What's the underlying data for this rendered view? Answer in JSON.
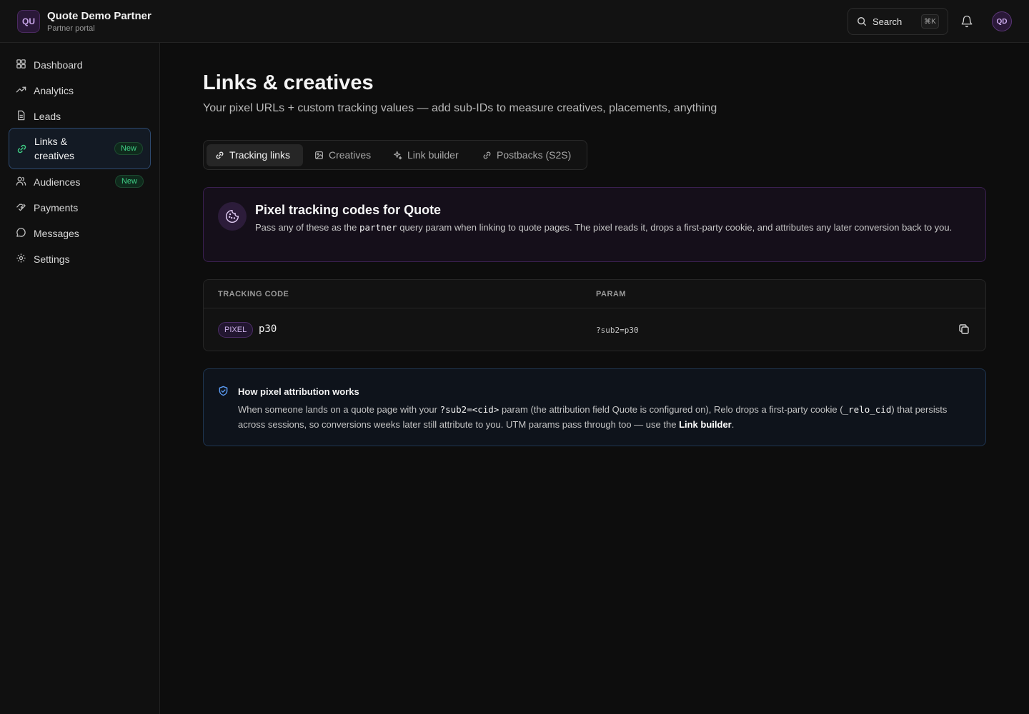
{
  "org": {
    "initials": "QU",
    "name": "Quote Demo Partner",
    "subtitle": "Partner portal"
  },
  "header": {
    "search_label": "Search",
    "search_shortcut": "⌘K",
    "user_initials": "QD"
  },
  "sidebar": {
    "items": [
      {
        "label": "Dashboard",
        "icon": "grid-icon"
      },
      {
        "label": "Analytics",
        "icon": "trend-icon"
      },
      {
        "label": "Leads",
        "icon": "document-icon"
      },
      {
        "label": "Links & creatives",
        "icon": "link-icon",
        "badge": "New",
        "active": true
      },
      {
        "label": "Audiences",
        "icon": "users-icon",
        "badge": "New"
      },
      {
        "label": "Payments",
        "icon": "payments-icon"
      },
      {
        "label": "Messages",
        "icon": "message-icon"
      },
      {
        "label": "Settings",
        "icon": "gear-icon"
      }
    ]
  },
  "main": {
    "title": "Links & creatives",
    "subtitle": "Your pixel URLs + custom tracking values — add sub-IDs to measure creatives, placements, anything",
    "tabs": [
      {
        "label": "Tracking links",
        "icon": "link-icon",
        "active": true
      },
      {
        "label": "Creatives",
        "icon": "image-icon"
      },
      {
        "label": "Link builder",
        "icon": "sparkle-icon"
      },
      {
        "label": "Postbacks (S2S)",
        "icon": "link-icon"
      }
    ]
  },
  "pixel_card": {
    "title": "Pixel tracking codes for Quote",
    "desc_before": "Pass any of these as the ",
    "desc_code": "partner",
    "desc_after": " query param when linking to quote pages. The pixel reads it, drops a first-party cookie, and attributes any later conversion back to you."
  },
  "table": {
    "headers": [
      "TRACKING CODE",
      "PARAM"
    ],
    "rows": [
      {
        "type": "PIXEL",
        "code": "p30",
        "param": "?sub2=p30"
      }
    ]
  },
  "help": {
    "title": "How pixel attribution works",
    "part1": "When someone lands on a quote page with your ",
    "code1": "?sub2=<cid>",
    "part2": " param (the attribution field Quote is configured on), Relo drops a first-party cookie (",
    "code2": "_relo_cid",
    "part3": ") that persists across sessions, so conversions weeks later still attribute to you. UTM params pass through too — use the ",
    "bold": "Link builder",
    "part4": "."
  },
  "colors": {
    "accent_purple": "#c9a6ea",
    "badge_green": "#3fcf86",
    "active_border": "#2e4a70"
  }
}
